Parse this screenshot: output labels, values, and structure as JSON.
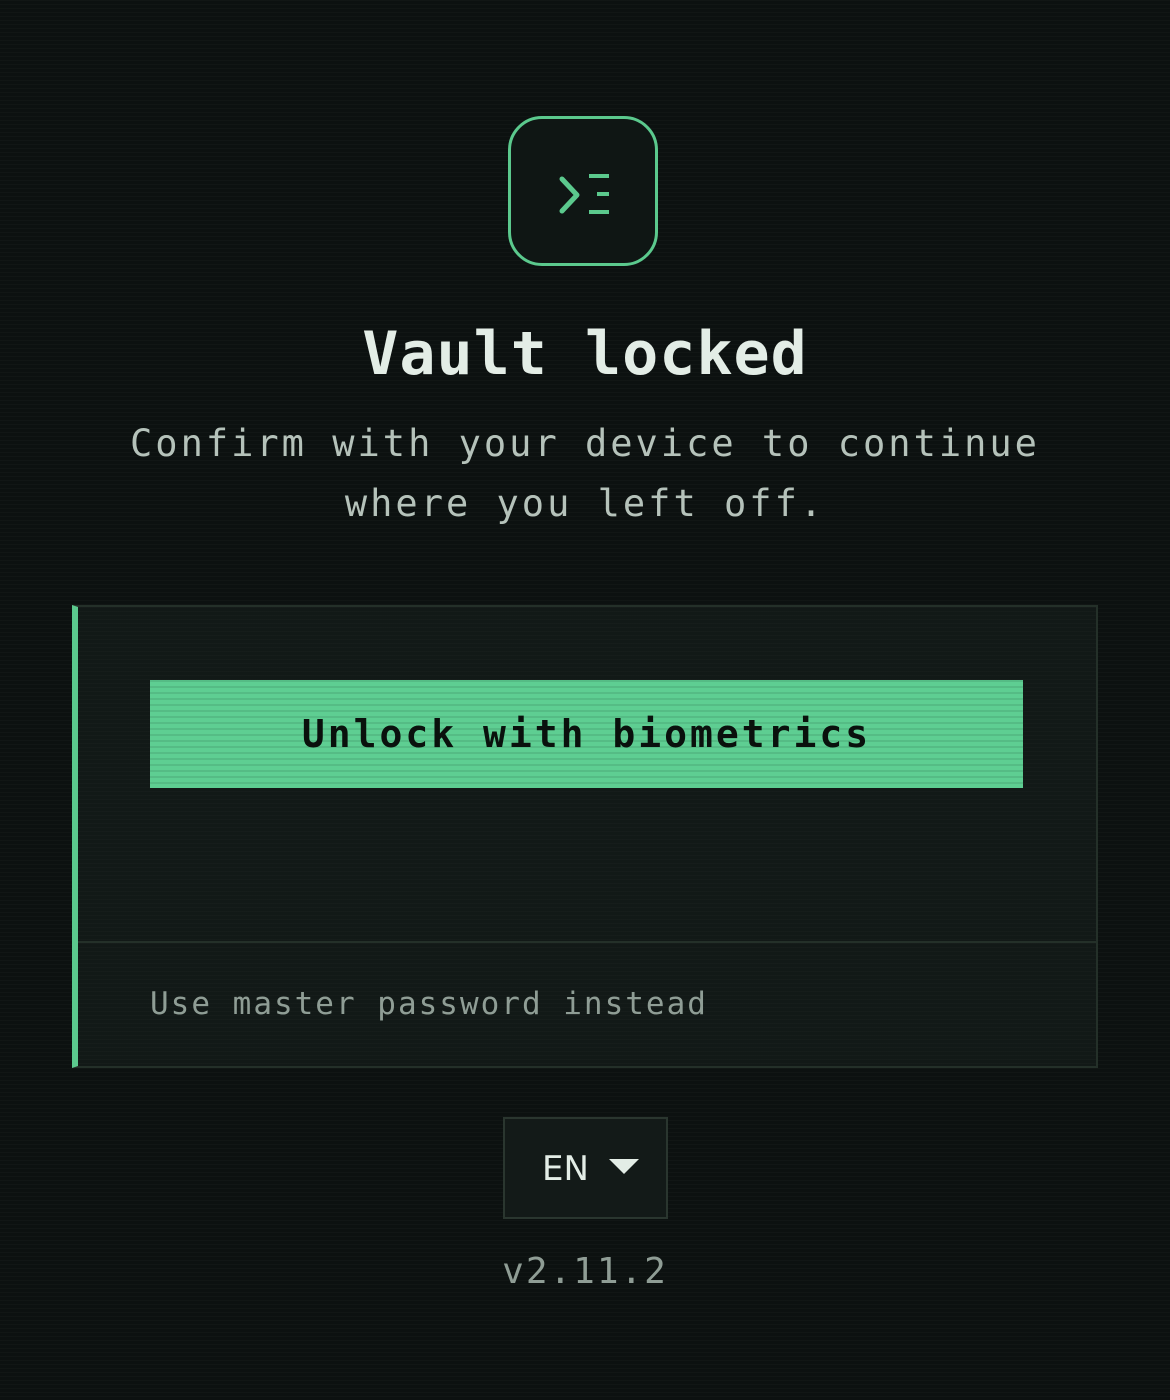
{
  "app_icon": "terminal-prompt-icon",
  "title": "Vault locked",
  "subtitle": "Confirm with your device to continue where you left off.",
  "unlock_card": {
    "primary_button_label": "Unlock with biometrics",
    "alternate_link_label": "Use master password instead"
  },
  "language": {
    "selected": "EN",
    "icon": "chevron-down-icon"
  },
  "version": "v2.11.2",
  "colors": {
    "accent": "#5ece92",
    "background": "#0c1110",
    "card": "#121917",
    "text_primary": "#e3ede6",
    "text_muted": "#8f9d95"
  }
}
